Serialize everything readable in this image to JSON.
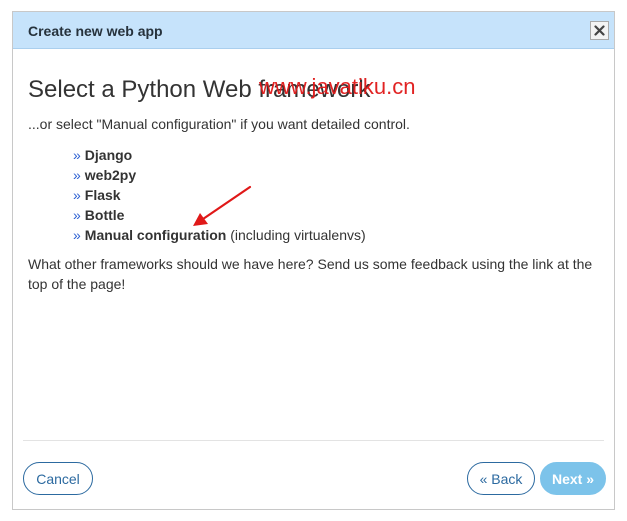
{
  "dialog": {
    "title": "Create new web app",
    "close_icon": "close-icon",
    "heading": "Select a Python Web framework",
    "subtitle": "...or select \"Manual configuration\" if you want detailed control.",
    "bullet": "»",
    "frameworks": [
      {
        "name": "Django",
        "note": ""
      },
      {
        "name": "web2py",
        "note": ""
      },
      {
        "name": "Flask",
        "note": ""
      },
      {
        "name": "Bottle",
        "note": ""
      },
      {
        "name": "Manual configuration",
        "note": "(including virtualenvs)"
      }
    ],
    "feedback": "What other frameworks should we have here? Send us some feedback using the link at the top of the page!",
    "buttons": {
      "cancel": "Cancel",
      "back": "« Back",
      "next": "Next »"
    }
  },
  "watermark": "www.javatiku.cn",
  "colors": {
    "titlebar": "#c6e3fb",
    "link_bullet": "#2b5fd1",
    "outline_button": "#2c6aa0",
    "next_button": "#7cc3ea",
    "annotation": "#e01818"
  }
}
